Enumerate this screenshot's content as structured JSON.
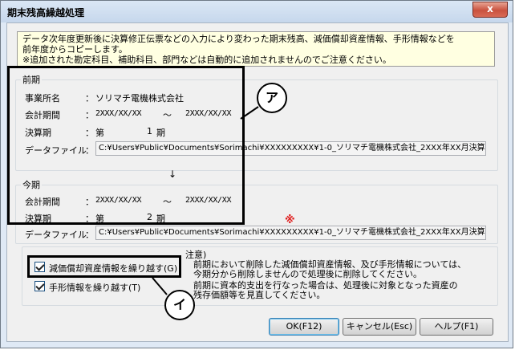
{
  "window": {
    "title": "期末残高繰越処理",
    "close_glyph": "x"
  },
  "info": {
    "lines": [
      "データ次年度更新後に決算修正伝票などの入力により変わった期末残高、減価償却資産情報、手形情報などを",
      "前年度からコピーします。",
      "※追加された勘定科目、補助科目、部門などは自動的に追加されませんのでご注意ください。"
    ]
  },
  "previous": {
    "legend": "前期",
    "company_label": "事業所名",
    "company_value": "ソリマチ電機株式会社",
    "period_label": "会計期間",
    "period_from": "2XXX/XX/XX",
    "period_sep": "〜",
    "period_to": "2XXX/XX/XX",
    "term_label": "決算期",
    "term_prefix": "第",
    "term_num": "1",
    "term_suffix": "期",
    "file_label": "データファイル",
    "file_path": "C:¥Users¥Public¥Documents¥Sorimachi¥XXXXXXXXX¥1-0_ソリマチ電機株式会社_2XXX年XX月決算.ACC"
  },
  "arrow": "↓",
  "current": {
    "legend": "今期",
    "period_label": "会計期間",
    "period_from": "2XXX/XX/XX",
    "period_sep": "〜",
    "period_to": "2XXX/XX/XX",
    "term_label": "決算期",
    "term_prefix": "第",
    "term_num": "2",
    "term_suffix": "期",
    "file_label": "データファイル",
    "file_path": "C:¥Users¥Public¥Documents¥Sorimachi¥XXXXXXXXX¥1-0_ソリマチ電機株式会社_2XXX年XX月決算.ACC",
    "marker": "※"
  },
  "colon": "：",
  "options": {
    "depreciation_label": "減価償却資産情報を繰り越す(G)",
    "depreciation_checked": true,
    "notes_label": "手形情報を繰り越す(T)",
    "notes_checked": true
  },
  "caution": {
    "title": "注意)",
    "lines": [
      "前期において削除した減価償却資産情報、及び手形情報については、",
      "今期分から削除しませんので処理後に削除してください。",
      "前期に資本的支出を行なった場合は、処理後に対象となった資産の",
      "残存価額等を見直してください。"
    ]
  },
  "buttons": {
    "ok": "OK(F12)",
    "cancel": "キャンセル(Esc)",
    "help": "ヘルプ(F1)"
  },
  "callouts": {
    "a": "ア",
    "i": "イ"
  }
}
